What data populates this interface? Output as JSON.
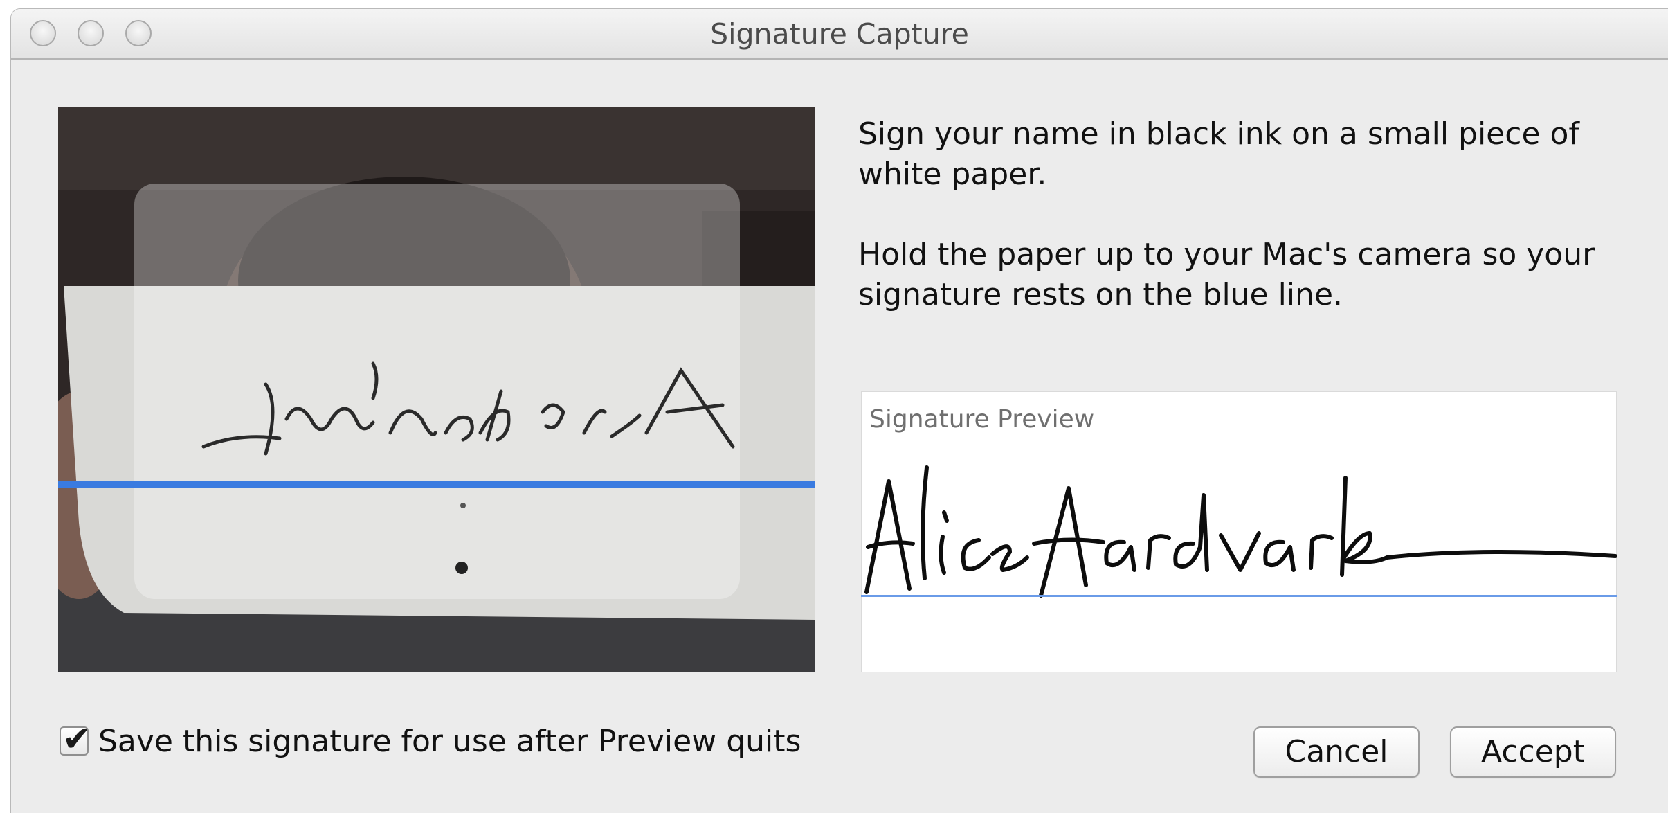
{
  "window": {
    "title": "Signature Capture"
  },
  "instructions": {
    "paragraph1": "Sign your name in black ink on a small piece of white paper.",
    "paragraph2": "Hold the paper up to your Mac's camera so your signature rests on the blue line."
  },
  "camera": {
    "mirrored_signature": "Alice Aardvark",
    "guide_line_color": "#3a7be0"
  },
  "preview": {
    "label": "Signature Preview",
    "signature": "Alice Aardvark",
    "baseline_color": "#6a9be8"
  },
  "footer": {
    "save_checkbox_label": "Save this signature for use after Preview quits",
    "save_checked": true,
    "cancel_label": "Cancel",
    "accept_label": "Accept"
  }
}
